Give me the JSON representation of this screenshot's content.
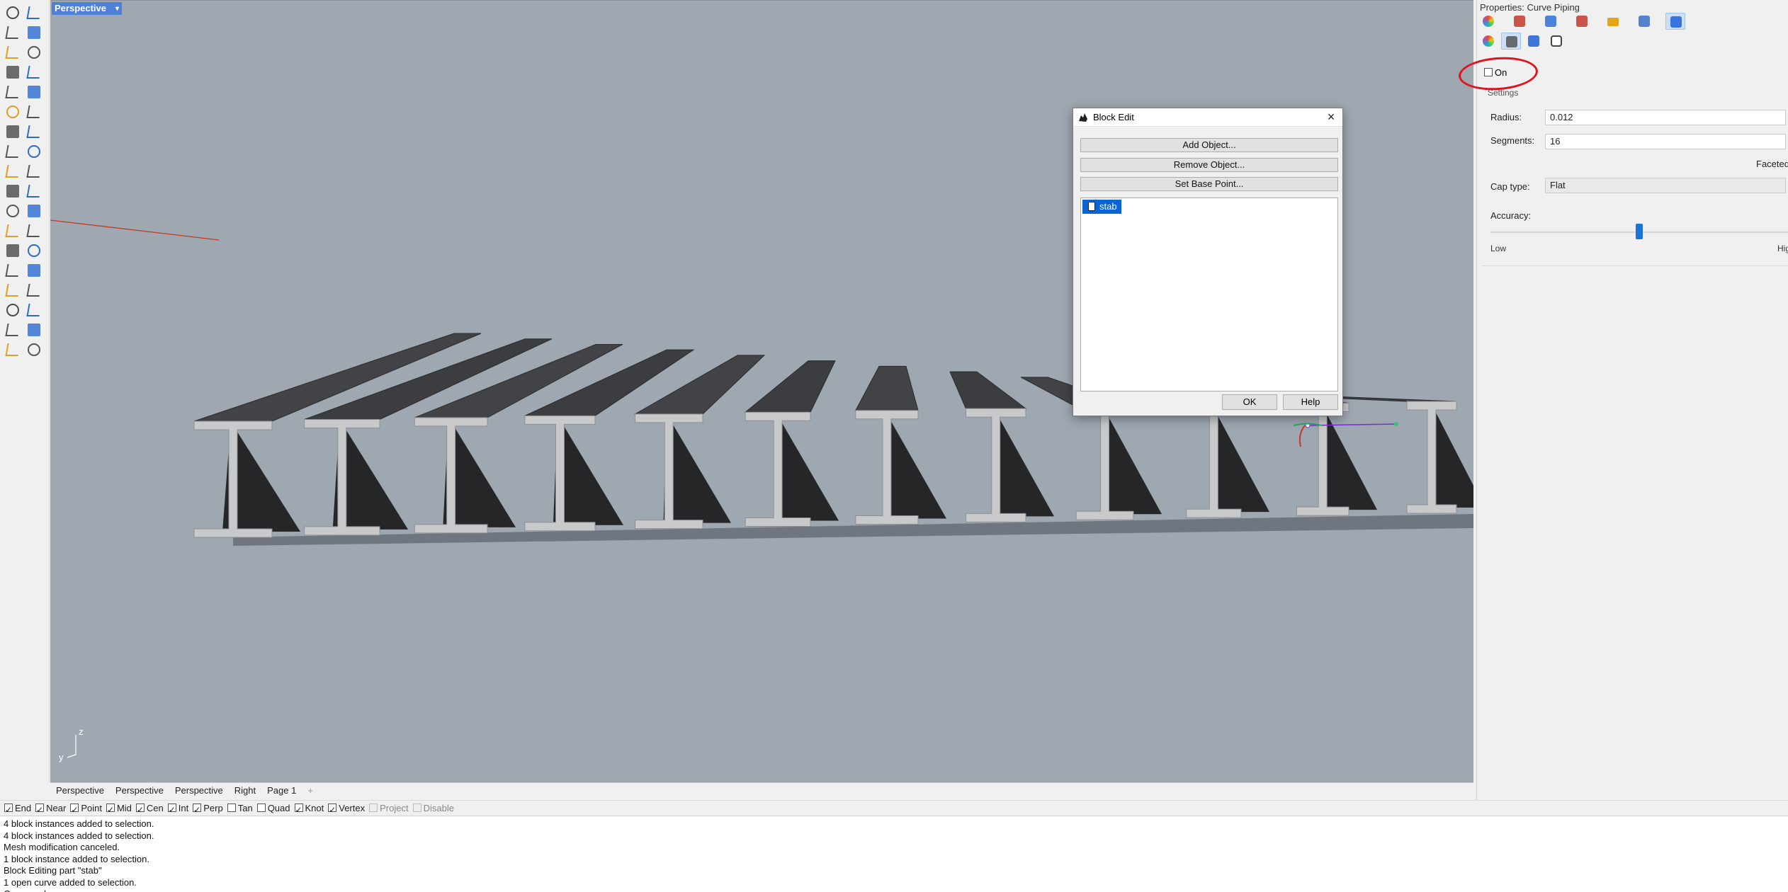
{
  "viewport": {
    "label": "Perspective",
    "menu_icon": "chevron-down-icon",
    "background": "#9fa7b1",
    "axes": {
      "z": "z",
      "y": "y"
    }
  },
  "viewport_tabs": [
    "Perspective",
    "Perspective",
    "Perspective",
    "Right",
    "Page 1",
    "+"
  ],
  "osnaps": [
    {
      "label": "End",
      "checked": true
    },
    {
      "label": "Near",
      "checked": true
    },
    {
      "label": "Point",
      "checked": true
    },
    {
      "label": "Mid",
      "checked": true
    },
    {
      "label": "Cen",
      "checked": true
    },
    {
      "label": "Int",
      "checked": true
    },
    {
      "label": "Perp",
      "checked": true
    },
    {
      "label": "Tan",
      "checked": false
    },
    {
      "label": "Quad",
      "checked": false
    },
    {
      "label": "Knot",
      "checked": true
    },
    {
      "label": "Vertex",
      "checked": true
    },
    {
      "label": "Project",
      "checked": false,
      "disabled": true
    },
    {
      "label": "Disable",
      "checked": false,
      "disabled": true
    }
  ],
  "history": [
    "4 block instances added to selection.",
    "4 block instances added to selection.",
    "Mesh modification canceled.",
    "1 block instance added to selection.",
    "Block Editing part \"stab\"",
    "1 open curve added to selection.",
    "Command:"
  ],
  "properties": {
    "title": "Properties: Curve Piping",
    "on_label": "On",
    "on_checked": false,
    "settings_label": "Settings",
    "radius_label": "Radius:",
    "radius_value": "0.012",
    "segments_label": "Segments:",
    "segments_value": "16",
    "faceted_label": "Faceted",
    "cap_type_label": "Cap type:",
    "cap_type_value": "Flat",
    "accuracy_label": "Accuracy:",
    "accuracy_level": 0.5,
    "low_label": "Low",
    "high_label": "High",
    "highlight_color": "#e0141a"
  },
  "dialog": {
    "title": "Block Edit",
    "add_label": "Add Object...",
    "remove_label": "Remove Object...",
    "basepoint_label": "Set Base Point...",
    "items": [
      "stab"
    ],
    "ok_label": "OK",
    "help_label": "Help"
  }
}
